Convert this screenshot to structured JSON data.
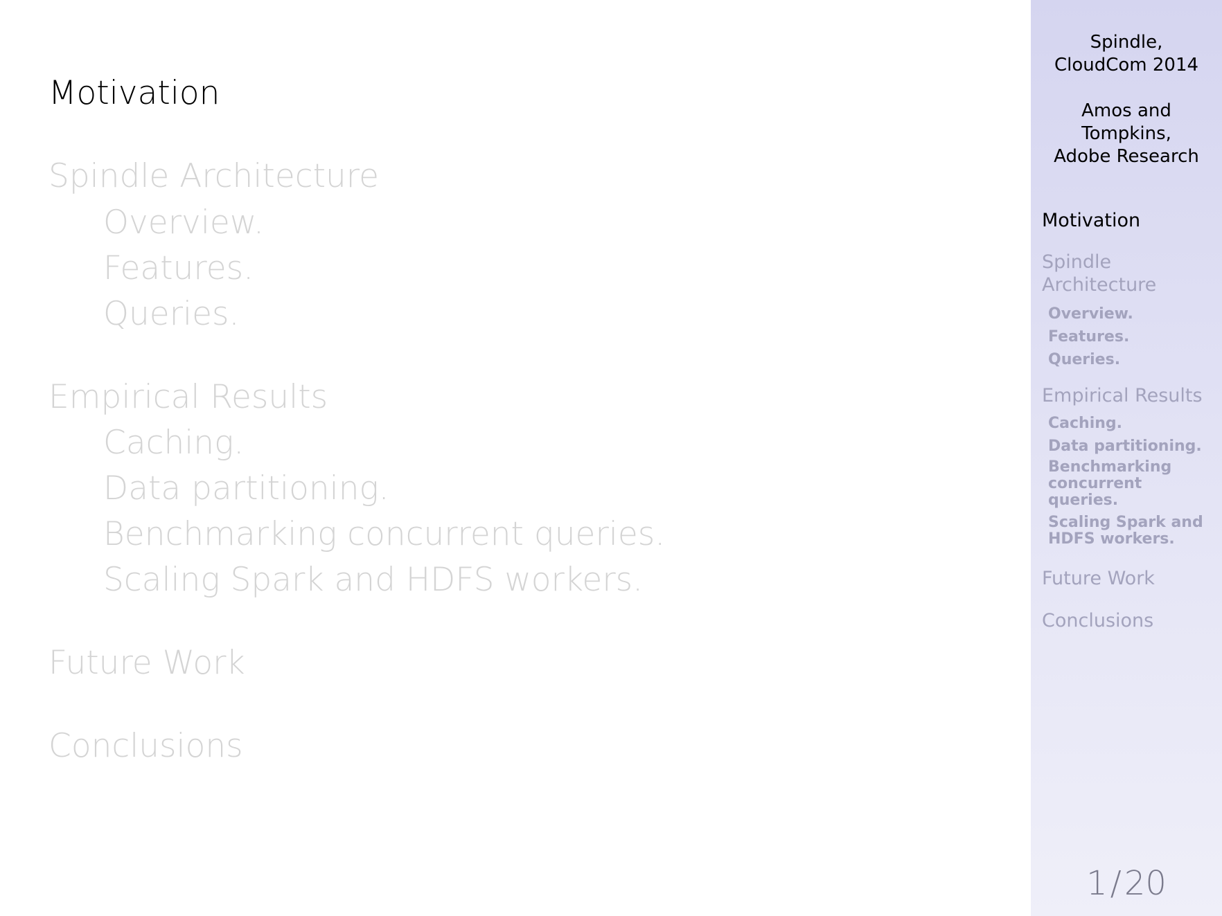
{
  "main": {
    "sections": [
      {
        "title": "Motivation",
        "active": true,
        "subsections": []
      },
      {
        "title": "Spindle Architecture",
        "active": false,
        "subsections": [
          "Overview.",
          "Features.",
          "Queries."
        ]
      },
      {
        "title": "Empirical Results",
        "active": false,
        "subsections": [
          "Caching.",
          "Data partitioning.",
          "Benchmarking concurrent queries.",
          "Scaling Spark and HDFS workers."
        ]
      },
      {
        "title": "Future Work",
        "active": false,
        "subsections": []
      },
      {
        "title": "Conclusions",
        "active": false,
        "subsections": []
      }
    ]
  },
  "sidebar": {
    "title_line1": "Spindle,",
    "title_line2": "CloudCom 2014",
    "authors_line1": "Amos and",
    "authors_line2": "Tompkins,",
    "authors_line3": "Adobe Research",
    "sections": [
      {
        "title": "Motivation",
        "active": true,
        "subsections": []
      },
      {
        "title": "Spindle Architecture",
        "active": false,
        "subsections": [
          "Overview.",
          "Features.",
          "Queries."
        ]
      },
      {
        "title": "Empirical Results",
        "active": false,
        "subsections": [
          "Caching.",
          "Data partitioning.",
          "Benchmarking concurrent queries.",
          "Scaling Spark and HDFS workers."
        ]
      },
      {
        "title": "Future Work",
        "active": false,
        "subsections": []
      },
      {
        "title": "Conclusions",
        "active": false,
        "subsections": []
      }
    ],
    "page_current": "1",
    "page_separator": "/",
    "page_total": "20"
  },
  "colors": {
    "active_text": "#000000",
    "faded_text": "#d4d4d4",
    "sidebar_bg_top": "#d5d5f0",
    "sidebar_bg_bottom": "#efeff9",
    "sidebar_faded_text": "#a3a3bd"
  }
}
